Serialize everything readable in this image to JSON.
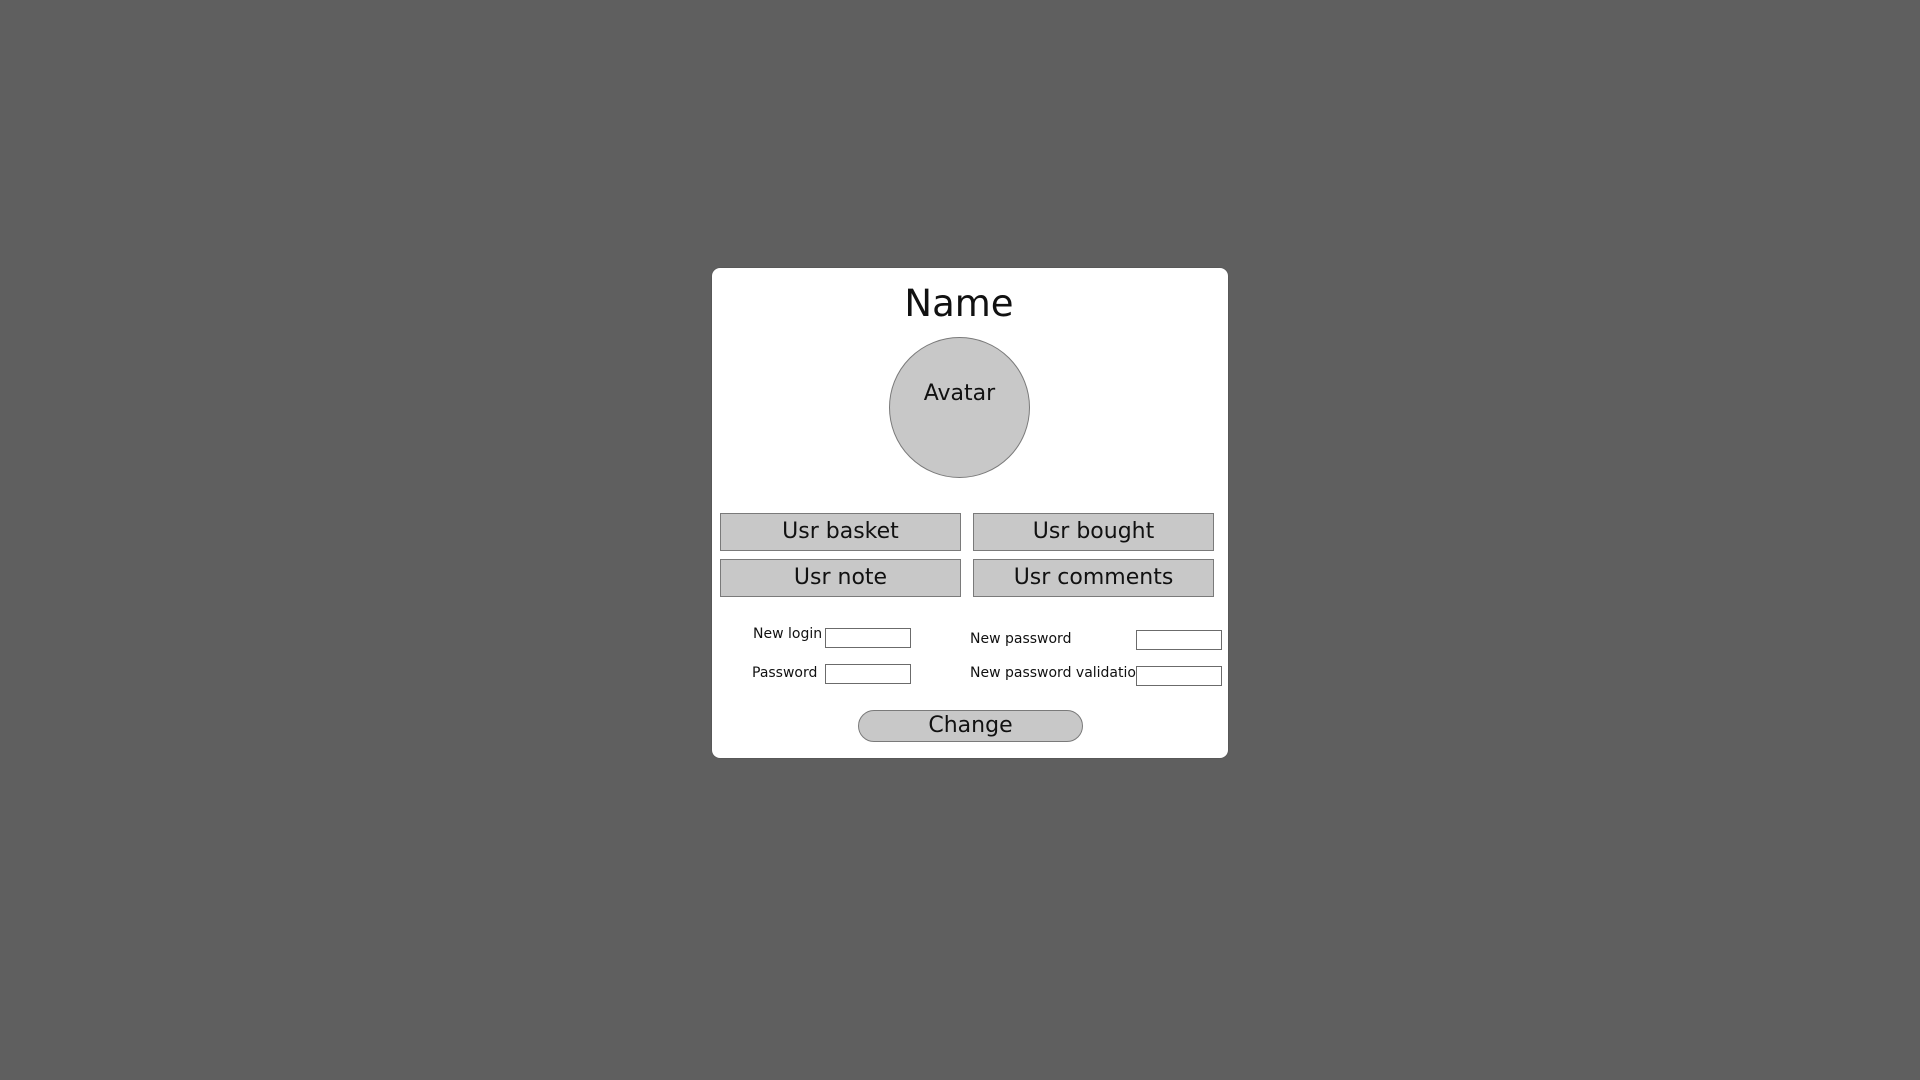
{
  "profile": {
    "name": "Name",
    "avatar_label": "Avatar"
  },
  "nav_buttons": [
    {
      "label": "Usr basket"
    },
    {
      "label": "Usr bought"
    },
    {
      "label": "Usr note"
    },
    {
      "label": "Usr comments"
    }
  ],
  "form": {
    "new_login_label": "New login",
    "new_login_value": "",
    "password_label": "Password",
    "password_value": "",
    "new_password_label": "New password",
    "new_password_value": "",
    "new_password_validation_label": "New password validation",
    "new_password_validation_value": "",
    "submit_label": "Change"
  },
  "colors": {
    "background": "#5f5f5f",
    "card": "#ffffff",
    "control_fill": "#c8c8c8",
    "control_border": "#7a7a7a"
  }
}
